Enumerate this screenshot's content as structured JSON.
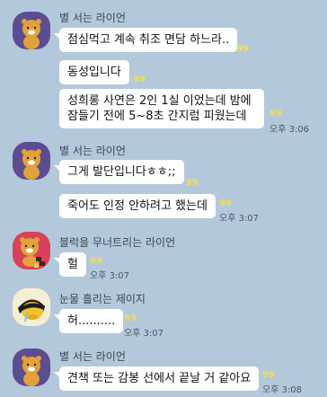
{
  "colors": {
    "background": "#b3c8db",
    "bubble": "#ffffff",
    "unread": "#f3dc5a"
  },
  "groups": [
    {
      "sender": "별 서는 라이언",
      "avatar": "ryan-standing-icon",
      "messages": [
        {
          "text": "점심먹고 계속 취조 면담 하느라..",
          "unread": "99",
          "time": ""
        },
        {
          "text": "동성입니다",
          "unread": "99",
          "time": ""
        },
        {
          "text": "성희롱 사연은 2인 1실 이었는데 밤에 잠들기 전에 5~8초 간지럼 피웠는데",
          "unread": "99",
          "time": "오후 3:06"
        }
      ]
    },
    {
      "sender": "별 서는 라이언",
      "avatar": "ryan-standing-icon",
      "messages": [
        {
          "text": "그게 발단입니다ㅎㅎ;;",
          "unread": "99",
          "time": ""
        },
        {
          "text": "죽어도 인정 안하려고 했는데",
          "unread": "99",
          "time": "오후 3:07"
        }
      ]
    },
    {
      "sender": "블럭을 무너트리는 라이언",
      "avatar": "ryan-blocks-icon",
      "messages": [
        {
          "text": "헐",
          "unread": "99",
          "time": "오후 3:07"
        }
      ]
    },
    {
      "sender": "눈물 흘리는 제이지",
      "avatar": "jayg-crying-icon",
      "messages": [
        {
          "text": "허..........",
          "unread": "99",
          "time": "오후 3:07"
        }
      ]
    },
    {
      "sender": "별 서는 라이언",
      "avatar": "ryan-standing-icon",
      "messages": [
        {
          "text": "견책 또는 감봉 선에서 끝날 거 같아요",
          "unread": "99",
          "time": "오후 3:08"
        }
      ]
    }
  ]
}
